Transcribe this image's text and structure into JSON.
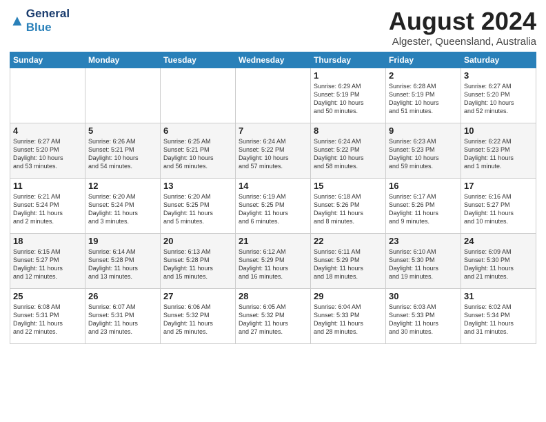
{
  "header": {
    "logo_general": "General",
    "logo_blue": "Blue",
    "month_year": "August 2024",
    "location": "Algester, Queensland, Australia"
  },
  "weekdays": [
    "Sunday",
    "Monday",
    "Tuesday",
    "Wednesday",
    "Thursday",
    "Friday",
    "Saturday"
  ],
  "rows": [
    [
      {
        "day": "",
        "info": ""
      },
      {
        "day": "",
        "info": ""
      },
      {
        "day": "",
        "info": ""
      },
      {
        "day": "",
        "info": ""
      },
      {
        "day": "1",
        "info": "Sunrise: 6:29 AM\nSunset: 5:19 PM\nDaylight: 10 hours\nand 50 minutes."
      },
      {
        "day": "2",
        "info": "Sunrise: 6:28 AM\nSunset: 5:19 PM\nDaylight: 10 hours\nand 51 minutes."
      },
      {
        "day": "3",
        "info": "Sunrise: 6:27 AM\nSunset: 5:20 PM\nDaylight: 10 hours\nand 52 minutes."
      }
    ],
    [
      {
        "day": "4",
        "info": "Sunrise: 6:27 AM\nSunset: 5:20 PM\nDaylight: 10 hours\nand 53 minutes."
      },
      {
        "day": "5",
        "info": "Sunrise: 6:26 AM\nSunset: 5:21 PM\nDaylight: 10 hours\nand 54 minutes."
      },
      {
        "day": "6",
        "info": "Sunrise: 6:25 AM\nSunset: 5:21 PM\nDaylight: 10 hours\nand 56 minutes."
      },
      {
        "day": "7",
        "info": "Sunrise: 6:24 AM\nSunset: 5:22 PM\nDaylight: 10 hours\nand 57 minutes."
      },
      {
        "day": "8",
        "info": "Sunrise: 6:24 AM\nSunset: 5:22 PM\nDaylight: 10 hours\nand 58 minutes."
      },
      {
        "day": "9",
        "info": "Sunrise: 6:23 AM\nSunset: 5:23 PM\nDaylight: 10 hours\nand 59 minutes."
      },
      {
        "day": "10",
        "info": "Sunrise: 6:22 AM\nSunset: 5:23 PM\nDaylight: 11 hours\nand 1 minute."
      }
    ],
    [
      {
        "day": "11",
        "info": "Sunrise: 6:21 AM\nSunset: 5:24 PM\nDaylight: 11 hours\nand 2 minutes."
      },
      {
        "day": "12",
        "info": "Sunrise: 6:20 AM\nSunset: 5:24 PM\nDaylight: 11 hours\nand 3 minutes."
      },
      {
        "day": "13",
        "info": "Sunrise: 6:20 AM\nSunset: 5:25 PM\nDaylight: 11 hours\nand 5 minutes."
      },
      {
        "day": "14",
        "info": "Sunrise: 6:19 AM\nSunset: 5:25 PM\nDaylight: 11 hours\nand 6 minutes."
      },
      {
        "day": "15",
        "info": "Sunrise: 6:18 AM\nSunset: 5:26 PM\nDaylight: 11 hours\nand 8 minutes."
      },
      {
        "day": "16",
        "info": "Sunrise: 6:17 AM\nSunset: 5:26 PM\nDaylight: 11 hours\nand 9 minutes."
      },
      {
        "day": "17",
        "info": "Sunrise: 6:16 AM\nSunset: 5:27 PM\nDaylight: 11 hours\nand 10 minutes."
      }
    ],
    [
      {
        "day": "18",
        "info": "Sunrise: 6:15 AM\nSunset: 5:27 PM\nDaylight: 11 hours\nand 12 minutes."
      },
      {
        "day": "19",
        "info": "Sunrise: 6:14 AM\nSunset: 5:28 PM\nDaylight: 11 hours\nand 13 minutes."
      },
      {
        "day": "20",
        "info": "Sunrise: 6:13 AM\nSunset: 5:28 PM\nDaylight: 11 hours\nand 15 minutes."
      },
      {
        "day": "21",
        "info": "Sunrise: 6:12 AM\nSunset: 5:29 PM\nDaylight: 11 hours\nand 16 minutes."
      },
      {
        "day": "22",
        "info": "Sunrise: 6:11 AM\nSunset: 5:29 PM\nDaylight: 11 hours\nand 18 minutes."
      },
      {
        "day": "23",
        "info": "Sunrise: 6:10 AM\nSunset: 5:30 PM\nDaylight: 11 hours\nand 19 minutes."
      },
      {
        "day": "24",
        "info": "Sunrise: 6:09 AM\nSunset: 5:30 PM\nDaylight: 11 hours\nand 21 minutes."
      }
    ],
    [
      {
        "day": "25",
        "info": "Sunrise: 6:08 AM\nSunset: 5:31 PM\nDaylight: 11 hours\nand 22 minutes."
      },
      {
        "day": "26",
        "info": "Sunrise: 6:07 AM\nSunset: 5:31 PM\nDaylight: 11 hours\nand 23 minutes."
      },
      {
        "day": "27",
        "info": "Sunrise: 6:06 AM\nSunset: 5:32 PM\nDaylight: 11 hours\nand 25 minutes."
      },
      {
        "day": "28",
        "info": "Sunrise: 6:05 AM\nSunset: 5:32 PM\nDaylight: 11 hours\nand 27 minutes."
      },
      {
        "day": "29",
        "info": "Sunrise: 6:04 AM\nSunset: 5:33 PM\nDaylight: 11 hours\nand 28 minutes."
      },
      {
        "day": "30",
        "info": "Sunrise: 6:03 AM\nSunset: 5:33 PM\nDaylight: 11 hours\nand 30 minutes."
      },
      {
        "day": "31",
        "info": "Sunrise: 6:02 AM\nSunset: 5:34 PM\nDaylight: 11 hours\nand 31 minutes."
      }
    ]
  ]
}
